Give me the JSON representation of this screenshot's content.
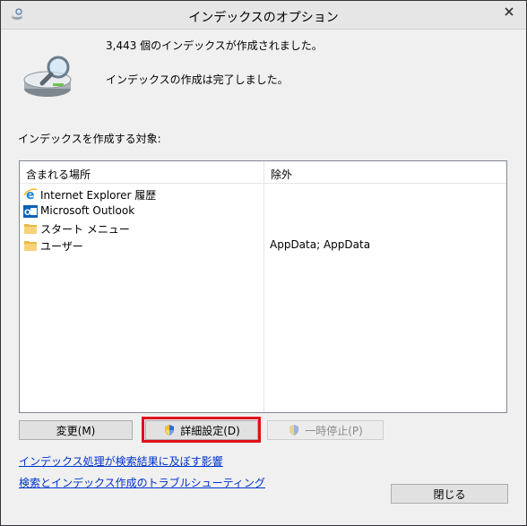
{
  "window": {
    "title": "インデックスのオプション",
    "close_icon": "close-icon"
  },
  "status": {
    "count_line": "3,443 個のインデックスが作成されました。",
    "state_line": "インデックスの作成は完了しました。"
  },
  "locations": {
    "label": "インデックスを作成する対象:",
    "columns": [
      "含まれる場所",
      "除外"
    ],
    "rows": [
      {
        "icon": "internet-explorer-icon",
        "name": "Internet Explorer 履歴",
        "exclude": ""
      },
      {
        "icon": "outlook-icon",
        "name": "Microsoft Outlook",
        "exclude": ""
      },
      {
        "icon": "folder-icon",
        "name": "スタート メニュー",
        "exclude": ""
      },
      {
        "icon": "folder-icon",
        "name": "ユーザー",
        "exclude": "AppData; AppData"
      }
    ]
  },
  "buttons": {
    "modify": "変更(M)",
    "advanced": "詳細設定(D)",
    "pause": "一時停止(P)",
    "close": "閉じる"
  },
  "links": {
    "search_results": "インデックス処理が検索結果に及ぼす影響",
    "troubleshoot": "検索とインデックス作成のトラブルシューティング"
  },
  "colors": {
    "link": "#0033cc",
    "highlight": "#e0101a"
  }
}
